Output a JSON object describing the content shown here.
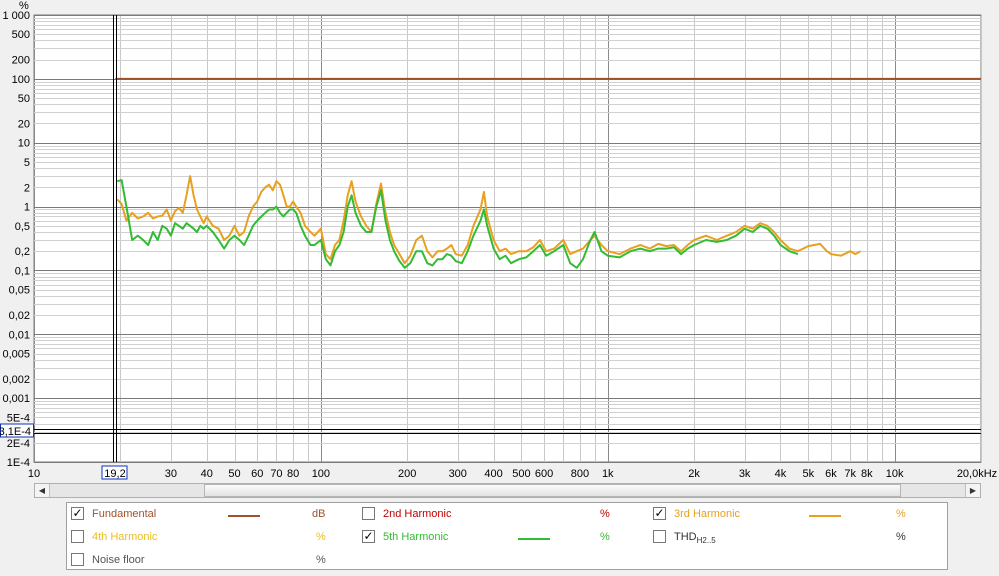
{
  "chart_data": {
    "type": "line",
    "x_scale": "log",
    "y_scale": "log",
    "xlim": [
      10,
      20000
    ],
    "ylim": [
      0.0001,
      1000
    ],
    "y_unit": "%",
    "x_unit_label": "20,0kHz",
    "cursor_x_label": "19,2",
    "cursor_y_label": "3,1E-4",
    "grid": true,
    "y_ticks": [
      {
        "v": 1000,
        "l": "1 000"
      },
      {
        "v": 500,
        "l": "500"
      },
      {
        "v": 200,
        "l": "200"
      },
      {
        "v": 100,
        "l": "100"
      },
      {
        "v": 50,
        "l": "50"
      },
      {
        "v": 20,
        "l": "20"
      },
      {
        "v": 10,
        "l": "10"
      },
      {
        "v": 5,
        "l": "5"
      },
      {
        "v": 2,
        "l": "2"
      },
      {
        "v": 1,
        "l": "1"
      },
      {
        "v": 0.5,
        "l": "0,5"
      },
      {
        "v": 0.2,
        "l": "0,2"
      },
      {
        "v": 0.1,
        "l": "0,1"
      },
      {
        "v": 0.05,
        "l": "0,05"
      },
      {
        "v": 0.02,
        "l": "0,02"
      },
      {
        "v": 0.01,
        "l": "0,01"
      },
      {
        "v": 0.005,
        "l": "0,005"
      },
      {
        "v": 0.002,
        "l": "0,002"
      },
      {
        "v": 0.001,
        "l": "0,001"
      },
      {
        "v": 0.0005,
        "l": "5E-4"
      },
      {
        "v": 0.0002,
        "l": "2E-4"
      },
      {
        "v": 0.0001,
        "l": "1E-4"
      }
    ],
    "x_ticks": [
      {
        "v": 10,
        "l": "10"
      },
      {
        "v": 30,
        "l": "30"
      },
      {
        "v": 40,
        "l": "40"
      },
      {
        "v": 50,
        "l": "50"
      },
      {
        "v": 60,
        "l": "60"
      },
      {
        "v": 70,
        "l": "70"
      },
      {
        "v": 80,
        "l": "80"
      },
      {
        "v": 100,
        "l": "100"
      },
      {
        "v": 200,
        "l": "200"
      },
      {
        "v": 300,
        "l": "300"
      },
      {
        "v": 400,
        "l": "400"
      },
      {
        "v": 500,
        "l": "500"
      },
      {
        "v": 600,
        "l": "600"
      },
      {
        "v": 800,
        "l": "800"
      },
      {
        "v": 1000,
        "l": "1k"
      },
      {
        "v": 2000,
        "l": "2k"
      },
      {
        "v": 3000,
        "l": "3k"
      },
      {
        "v": 4000,
        "l": "4k"
      },
      {
        "v": 5000,
        "l": "5k"
      },
      {
        "v": 6000,
        "l": "6k"
      },
      {
        "v": 7000,
        "l": "7k"
      },
      {
        "v": 8000,
        "l": "8k"
      },
      {
        "v": 10000,
        "l": "10k"
      }
    ],
    "series": [
      {
        "name": "Fundamental",
        "color": "#a0522d",
        "points": [
          [
            19.2,
            100
          ],
          [
            20000,
            100
          ]
        ]
      },
      {
        "name": "3rd Harmonic",
        "color": "#e8a020",
        "points": [
          [
            19.5,
            1.3
          ],
          [
            20.2,
            1.1
          ],
          [
            21,
            0.6
          ],
          [
            22,
            0.8
          ],
          [
            23,
            0.65
          ],
          [
            24,
            0.7
          ],
          [
            25,
            0.8
          ],
          [
            26,
            0.65
          ],
          [
            27,
            0.7
          ],
          [
            28,
            0.72
          ],
          [
            29,
            0.9
          ],
          [
            30,
            0.6
          ],
          [
            31,
            0.85
          ],
          [
            32,
            0.95
          ],
          [
            33,
            0.8
          ],
          [
            34,
            1.5
          ],
          [
            35,
            3.0
          ],
          [
            36,
            1.5
          ],
          [
            37,
            0.9
          ],
          [
            38,
            0.7
          ],
          [
            39,
            0.55
          ],
          [
            40,
            0.7
          ],
          [
            42,
            0.5
          ],
          [
            44,
            0.45
          ],
          [
            46,
            0.3
          ],
          [
            48,
            0.35
          ],
          [
            50,
            0.5
          ],
          [
            52,
            0.35
          ],
          [
            54,
            0.4
          ],
          [
            56,
            0.7
          ],
          [
            58,
            1.0
          ],
          [
            60,
            1.2
          ],
          [
            62,
            1.7
          ],
          [
            64,
            2.0
          ],
          [
            66,
            2.2
          ],
          [
            68,
            1.8
          ],
          [
            70,
            2.5
          ],
          [
            72,
            2.2
          ],
          [
            74,
            1.5
          ],
          [
            76,
            1.0
          ],
          [
            78,
            1.0
          ],
          [
            80,
            1.2
          ],
          [
            82,
            1.0
          ],
          [
            85,
            0.8
          ],
          [
            88,
            0.5
          ],
          [
            92,
            0.4
          ],
          [
            95,
            0.35
          ],
          [
            100,
            0.45
          ],
          [
            104,
            0.18
          ],
          [
            108,
            0.15
          ],
          [
            112,
            0.25
          ],
          [
            116,
            0.3
          ],
          [
            120,
            0.6
          ],
          [
            124,
            1.5
          ],
          [
            128,
            2.5
          ],
          [
            132,
            1.2
          ],
          [
            138,
            0.7
          ],
          [
            144,
            0.5
          ],
          [
            150,
            0.4
          ],
          [
            156,
            1.1
          ],
          [
            162,
            2.3
          ],
          [
            168,
            0.8
          ],
          [
            174,
            0.4
          ],
          [
            180,
            0.25
          ],
          [
            188,
            0.18
          ],
          [
            196,
            0.13
          ],
          [
            205,
            0.17
          ],
          [
            215,
            0.3
          ],
          [
            225,
            0.35
          ],
          [
            235,
            0.2
          ],
          [
            245,
            0.16
          ],
          [
            255,
            0.2
          ],
          [
            265,
            0.2
          ],
          [
            275,
            0.22
          ],
          [
            285,
            0.25
          ],
          [
            295,
            0.18
          ],
          [
            310,
            0.17
          ],
          [
            325,
            0.25
          ],
          [
            340,
            0.5
          ],
          [
            360,
            0.9
          ],
          [
            370,
            1.7
          ],
          [
            380,
            0.7
          ],
          [
            400,
            0.3
          ],
          [
            420,
            0.2
          ],
          [
            440,
            0.22
          ],
          [
            460,
            0.18
          ],
          [
            490,
            0.2
          ],
          [
            520,
            0.2
          ],
          [
            550,
            0.23
          ],
          [
            580,
            0.3
          ],
          [
            610,
            0.2
          ],
          [
            650,
            0.22
          ],
          [
            700,
            0.3
          ],
          [
            740,
            0.18
          ],
          [
            780,
            0.2
          ],
          [
            820,
            0.22
          ],
          [
            870,
            0.3
          ],
          [
            900,
            0.35
          ],
          [
            950,
            0.25
          ],
          [
            1000,
            0.2
          ],
          [
            1100,
            0.18
          ],
          [
            1200,
            0.22
          ],
          [
            1300,
            0.25
          ],
          [
            1400,
            0.22
          ],
          [
            1500,
            0.26
          ],
          [
            1600,
            0.24
          ],
          [
            1700,
            0.25
          ],
          [
            1800,
            0.2
          ],
          [
            1900,
            0.25
          ],
          [
            2000,
            0.3
          ],
          [
            2200,
            0.35
          ],
          [
            2400,
            0.3
          ],
          [
            2600,
            0.35
          ],
          [
            2800,
            0.4
          ],
          [
            3000,
            0.5
          ],
          [
            3200,
            0.45
          ],
          [
            3400,
            0.55
          ],
          [
            3600,
            0.5
          ],
          [
            3800,
            0.4
          ],
          [
            4000,
            0.3
          ],
          [
            4300,
            0.22
          ],
          [
            4600,
            0.2
          ],
          [
            5000,
            0.24
          ],
          [
            5500,
            0.26
          ],
          [
            5800,
            0.2
          ],
          [
            6000,
            0.18
          ],
          [
            6500,
            0.17
          ],
          [
            7000,
            0.2
          ],
          [
            7300,
            0.18
          ],
          [
            7600,
            0.2
          ]
        ]
      },
      {
        "name": "5th Harmonic",
        "color": "#33bb33",
        "points": [
          [
            19.5,
            2.5
          ],
          [
            20.2,
            2.6
          ],
          [
            21,
            1.0
          ],
          [
            22,
            0.3
          ],
          [
            23,
            0.35
          ],
          [
            24,
            0.3
          ],
          [
            25,
            0.25
          ],
          [
            26,
            0.4
          ],
          [
            27,
            0.3
          ],
          [
            28,
            0.5
          ],
          [
            29,
            0.45
          ],
          [
            30,
            0.35
          ],
          [
            31,
            0.55
          ],
          [
            32,
            0.5
          ],
          [
            33,
            0.45
          ],
          [
            34,
            0.55
          ],
          [
            35,
            0.5
          ],
          [
            36,
            0.45
          ],
          [
            37,
            0.4
          ],
          [
            38,
            0.5
          ],
          [
            39,
            0.45
          ],
          [
            40,
            0.5
          ],
          [
            42,
            0.4
          ],
          [
            44,
            0.3
          ],
          [
            46,
            0.22
          ],
          [
            48,
            0.3
          ],
          [
            50,
            0.35
          ],
          [
            52,
            0.3
          ],
          [
            54,
            0.25
          ],
          [
            56,
            0.35
          ],
          [
            58,
            0.5
          ],
          [
            60,
            0.6
          ],
          [
            62,
            0.7
          ],
          [
            64,
            0.8
          ],
          [
            66,
            0.9
          ],
          [
            68,
            0.9
          ],
          [
            70,
            1.0
          ],
          [
            72,
            0.8
          ],
          [
            74,
            0.7
          ],
          [
            76,
            0.8
          ],
          [
            78,
            0.9
          ],
          [
            80,
            0.9
          ],
          [
            82,
            0.8
          ],
          [
            85,
            0.5
          ],
          [
            88,
            0.35
          ],
          [
            92,
            0.25
          ],
          [
            95,
            0.25
          ],
          [
            100,
            0.3
          ],
          [
            104,
            0.15
          ],
          [
            108,
            0.12
          ],
          [
            112,
            0.2
          ],
          [
            116,
            0.25
          ],
          [
            120,
            0.4
          ],
          [
            124,
            1.0
          ],
          [
            128,
            1.5
          ],
          [
            132,
            0.8
          ],
          [
            138,
            0.5
          ],
          [
            144,
            0.4
          ],
          [
            150,
            0.4
          ],
          [
            156,
            1.0
          ],
          [
            162,
            1.8
          ],
          [
            168,
            0.6
          ],
          [
            174,
            0.3
          ],
          [
            180,
            0.2
          ],
          [
            188,
            0.14
          ],
          [
            196,
            0.11
          ],
          [
            205,
            0.13
          ],
          [
            215,
            0.2
          ],
          [
            225,
            0.2
          ],
          [
            235,
            0.13
          ],
          [
            245,
            0.12
          ],
          [
            255,
            0.15
          ],
          [
            265,
            0.15
          ],
          [
            275,
            0.18
          ],
          [
            285,
            0.17
          ],
          [
            295,
            0.14
          ],
          [
            310,
            0.13
          ],
          [
            325,
            0.2
          ],
          [
            340,
            0.35
          ],
          [
            360,
            0.6
          ],
          [
            370,
            0.9
          ],
          [
            380,
            0.5
          ],
          [
            400,
            0.22
          ],
          [
            420,
            0.15
          ],
          [
            440,
            0.17
          ],
          [
            460,
            0.13
          ],
          [
            490,
            0.15
          ],
          [
            520,
            0.16
          ],
          [
            550,
            0.2
          ],
          [
            580,
            0.25
          ],
          [
            610,
            0.17
          ],
          [
            650,
            0.2
          ],
          [
            700,
            0.25
          ],
          [
            740,
            0.13
          ],
          [
            780,
            0.11
          ],
          [
            820,
            0.15
          ],
          [
            870,
            0.3
          ],
          [
            900,
            0.4
          ],
          [
            950,
            0.2
          ],
          [
            1000,
            0.17
          ],
          [
            1100,
            0.16
          ],
          [
            1200,
            0.2
          ],
          [
            1300,
            0.22
          ],
          [
            1400,
            0.2
          ],
          [
            1500,
            0.22
          ],
          [
            1600,
            0.22
          ],
          [
            1700,
            0.23
          ],
          [
            1800,
            0.18
          ],
          [
            1900,
            0.22
          ],
          [
            2000,
            0.25
          ],
          [
            2200,
            0.3
          ],
          [
            2400,
            0.28
          ],
          [
            2600,
            0.3
          ],
          [
            2800,
            0.35
          ],
          [
            3000,
            0.45
          ],
          [
            3200,
            0.4
          ],
          [
            3400,
            0.5
          ],
          [
            3600,
            0.45
          ],
          [
            3800,
            0.35
          ],
          [
            4000,
            0.25
          ],
          [
            4300,
            0.2
          ],
          [
            4600,
            0.18
          ]
        ]
      }
    ]
  },
  "legend": {
    "fundamental": {
      "label": "Fundamental",
      "unit": "dB",
      "checked": true,
      "color": "#a0522d"
    },
    "h2": {
      "label": "2nd Harmonic",
      "unit": "%",
      "checked": false,
      "color": "#c00000"
    },
    "h3": {
      "label": "3rd Harmonic",
      "unit": "%",
      "checked": true,
      "color": "#e8a020"
    },
    "h4": {
      "label": "4th Harmonic",
      "unit": "%",
      "checked": false,
      "color": "#e8c020"
    },
    "h5": {
      "label": "5th Harmonic",
      "unit": "%",
      "checked": true,
      "color": "#33bb33"
    },
    "thd": {
      "label": "THD",
      "sub": "H2..5",
      "unit": "%",
      "checked": false,
      "color": "#333333"
    },
    "noise": {
      "label": "Noise floor",
      "unit": "%",
      "checked": false,
      "color": "#555555"
    }
  }
}
